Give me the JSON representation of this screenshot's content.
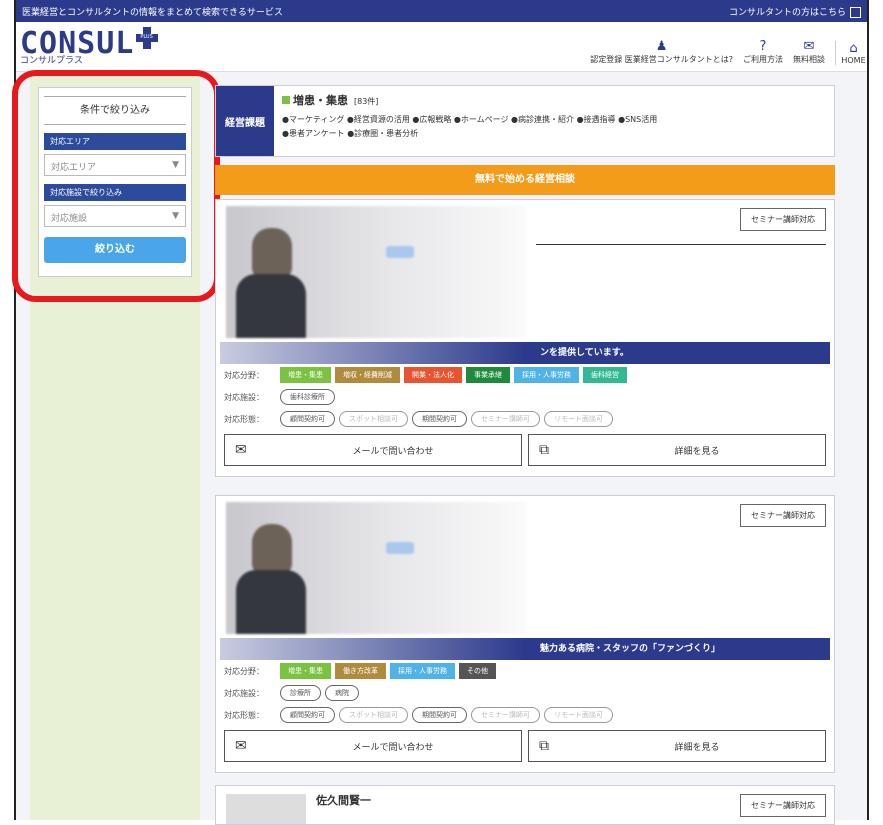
{
  "topbar": {
    "left": "医業経営とコンサルタントの情報をまとめて検索できるサービス",
    "right": "コンサルタントの方はこちら"
  },
  "header": {
    "logo_text": "CONSUL",
    "logo_badge": "PLUS",
    "logo_sub": "コンサルプラス",
    "nav": [
      {
        "icon": "♟",
        "label": "認定登録 医業経営コンサルタントとは?"
      },
      {
        "icon": "?",
        "label": "ご利用方法"
      },
      {
        "icon": "✉",
        "label": "無料相談"
      },
      {
        "icon": "⌂",
        "label": "HOME"
      }
    ]
  },
  "sidebar": {
    "title": "条件で絞り込み",
    "area_label": "対応エリア",
    "area_placeholder": "対応エリア",
    "facility_label": "対応施設で絞り込み",
    "facility_placeholder": "対応施設",
    "submit_label": "絞り込む"
  },
  "issue": {
    "label": "経営課題",
    "heading": "増患・集患",
    "count": "[83件]",
    "line1": "●マーケティング ●経営資源の活用 ●広報戦略 ●ホームページ ●病診連携・紹介 ●接遇指導 ●SNS活用",
    "line2": "●患者アンケート ●診療圏・患者分析"
  },
  "cta": "無料で始める経営相談",
  "cards": [
    {
      "seminar": "セミナー講師対応",
      "banner": "ンを提供しています。",
      "field_label": "対応分野：",
      "fields": [
        {
          "text": "増患・集患",
          "color": "#7bc241"
        },
        {
          "text": "増収・経費削減",
          "color": "#b08b3e"
        },
        {
          "text": "開業・法人化",
          "color": "#e8542f"
        },
        {
          "text": "事業承継",
          "color": "#1d8a3c"
        },
        {
          "text": "採用・人事労務",
          "color": "#4fb3e8"
        },
        {
          "text": "歯科経営",
          "color": "#33b894"
        }
      ],
      "facility_label": "対応施設：",
      "facilities": [
        "歯科診療所"
      ],
      "form_label": "対応形態：",
      "forms": [
        {
          "text": "顧問契約可",
          "dim": false
        },
        {
          "text": "スポット相談可",
          "dim": true
        },
        {
          "text": "期間契約可",
          "dim": false
        },
        {
          "text": "セミナー講師可",
          "dim": true
        },
        {
          "text": "リモート面談可",
          "dim": true
        }
      ],
      "mail_label": "メールで問い合わせ",
      "detail_label": "詳細を見る"
    },
    {
      "seminar": "セミナー講師対応",
      "banner": "魅力ある病院・スタッフの「ファンづくり」",
      "field_label": "対応分野：",
      "fields": [
        {
          "text": "増患・集患",
          "color": "#7bc241"
        },
        {
          "text": "働き方改革",
          "color": "#b08b3e"
        },
        {
          "text": "採用・人事労務",
          "color": "#4fb3e8"
        },
        {
          "text": "その他",
          "color": "#555555"
        }
      ],
      "facility_label": "対応施設：",
      "facilities": [
        "診療所",
        "病院"
      ],
      "form_label": "対応形態：",
      "forms": [
        {
          "text": "顧問契約可",
          "dim": false
        },
        {
          "text": "スポット相談可",
          "dim": true
        },
        {
          "text": "期間契約可",
          "dim": false
        },
        {
          "text": "セミナー講師可",
          "dim": true
        },
        {
          "text": "リモート面談可",
          "dim": true
        }
      ],
      "mail_label": "メールで問い合わせ",
      "detail_label": "詳細を見る"
    }
  ],
  "card3": {
    "name": "佐久間賢一",
    "seminar": "セミナー講師対応"
  },
  "colors": {
    "brand": "#2c3a8c",
    "accent": "#f39c1a",
    "highlight": "#e8191c"
  }
}
